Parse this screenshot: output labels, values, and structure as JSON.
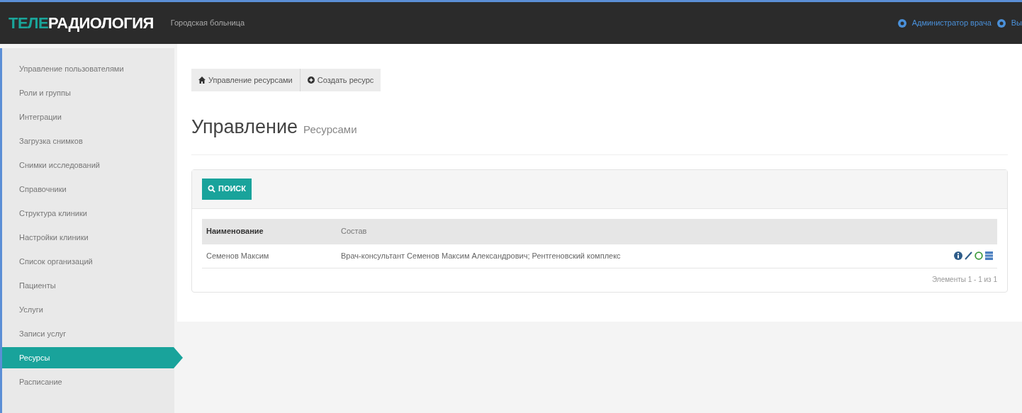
{
  "header": {
    "logo_accent": "ТЕЛЕ",
    "logo_rest": "РАДИОЛОГИЯ",
    "subtitle": "Городская больница",
    "user": "Администратор врача",
    "logout": "Вы"
  },
  "sidebar": {
    "items": [
      {
        "label": "Управление пользователями",
        "selected": false
      },
      {
        "label": "Роли и группы",
        "selected": false
      },
      {
        "label": "Интеграции",
        "selected": false
      },
      {
        "label": "Загрузка снимков",
        "selected": false
      },
      {
        "label": "Снимки исследований",
        "selected": false
      },
      {
        "label": "Справочники",
        "selected": false
      },
      {
        "label": "Структура клиники",
        "selected": false
      },
      {
        "label": "Настройки клиники",
        "selected": false
      },
      {
        "label": "Список организаций",
        "selected": false
      },
      {
        "label": "Пациенты",
        "selected": false
      },
      {
        "label": "Услуги",
        "selected": false
      },
      {
        "label": "Записи услуг",
        "selected": false
      },
      {
        "label": "Ресурсы",
        "selected": true
      },
      {
        "label": "Расписание",
        "selected": false
      }
    ]
  },
  "toolbar": [
    {
      "kind": "home",
      "label": "Управление ресурсами"
    },
    {
      "kind": "create",
      "label": "Создать ресурс"
    }
  ],
  "page_title": {
    "main": "Управление",
    "sub": "Ресурсами"
  },
  "search_button": "ПОИСК",
  "table": {
    "columns": [
      "Наименование",
      "Состав"
    ],
    "rows": [
      {
        "cells": [
          "Семенов Максим",
          "Врач-консультант Семенов Максим Александрович; Рентгеновский комплекс"
        ]
      }
    ]
  },
  "pager": "Элементы 1 - 1 из 1"
}
